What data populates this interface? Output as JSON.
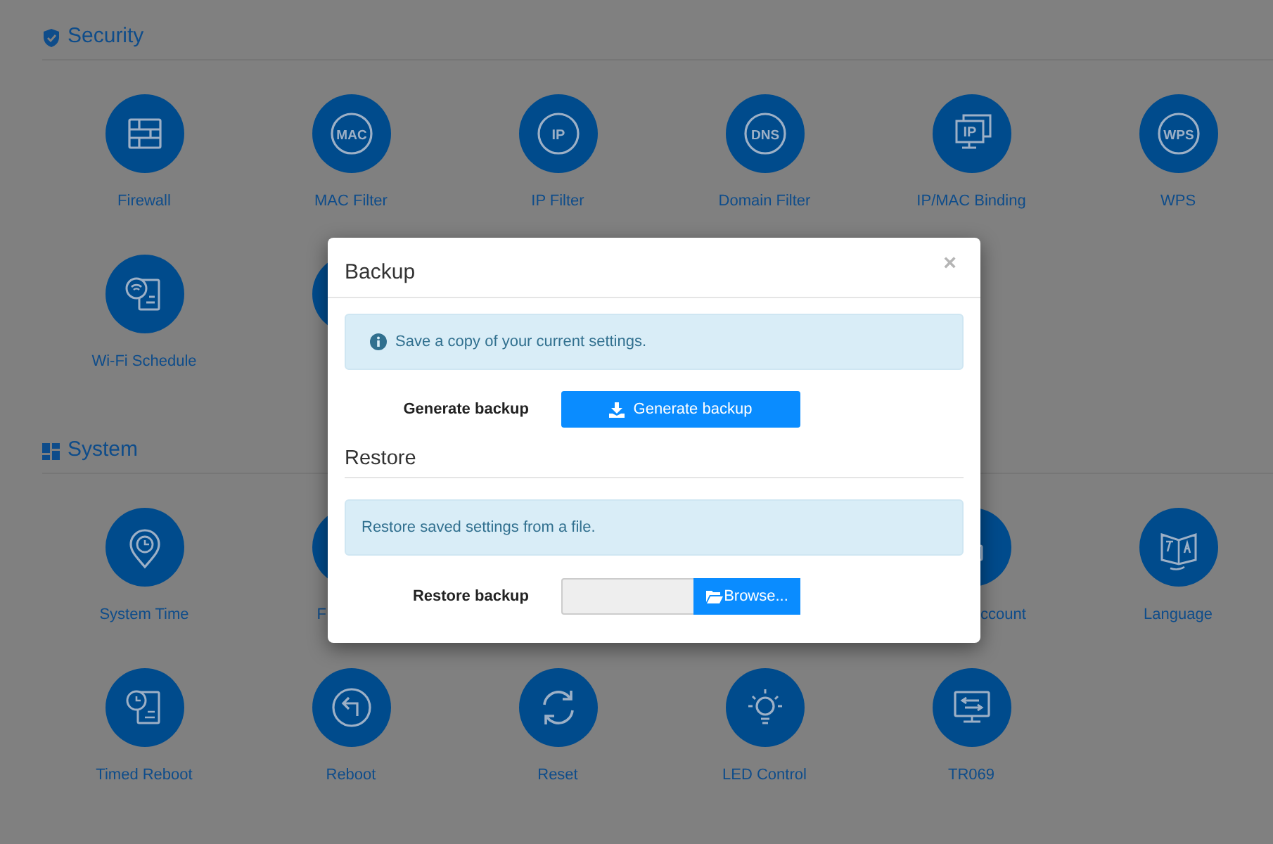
{
  "sections": [
    {
      "title": "Security",
      "items": [
        {
          "kind": "brick-wall",
          "label": "Firewall"
        },
        {
          "kind": "text-badge",
          "icon_text": "MAC",
          "label": "MAC Filter"
        },
        {
          "kind": "text-badge",
          "icon_text": "IP",
          "label": "IP Filter"
        },
        {
          "kind": "text-badge",
          "icon_text": "DNS",
          "label": "Domain Filter"
        },
        {
          "kind": "monitor-text",
          "icon_text": "IP",
          "label": "IP/MAC Binding"
        },
        {
          "kind": "text-badge",
          "icon_text": "WPS",
          "label": "WPS"
        },
        {
          "kind": "wifi-doc",
          "label": "Wi-Fi Schedule"
        },
        {
          "kind": "covered"
        }
      ]
    },
    {
      "title": "System",
      "items": [
        {
          "kind": "clock-pin",
          "label": "System Time"
        },
        {
          "kind": "covered-left",
          "label": "F"
        },
        {
          "kind": "hidden"
        },
        {
          "kind": "hidden"
        },
        {
          "kind": "covered-right",
          "label": "ccount"
        },
        {
          "kind": "language-book",
          "label": "Language"
        },
        {
          "kind": "clock-doc",
          "label": "Timed Reboot"
        },
        {
          "kind": "back-arrow",
          "label": "Reboot"
        },
        {
          "kind": "refresh",
          "label": "Reset"
        },
        {
          "kind": "bulb",
          "label": "LED Control"
        },
        {
          "kind": "monitor-arrows",
          "label": "TR069"
        }
      ]
    }
  ],
  "modal": {
    "title": "Backup",
    "close": "×",
    "backup_info": "Save a copy of your current settings.",
    "backup_label": "Generate backup",
    "backup_button": "Generate backup",
    "restore_title": "Restore",
    "restore_info": "Restore saved settings from a file.",
    "restore_label": "Restore backup",
    "browse_button": "Browse..."
  }
}
